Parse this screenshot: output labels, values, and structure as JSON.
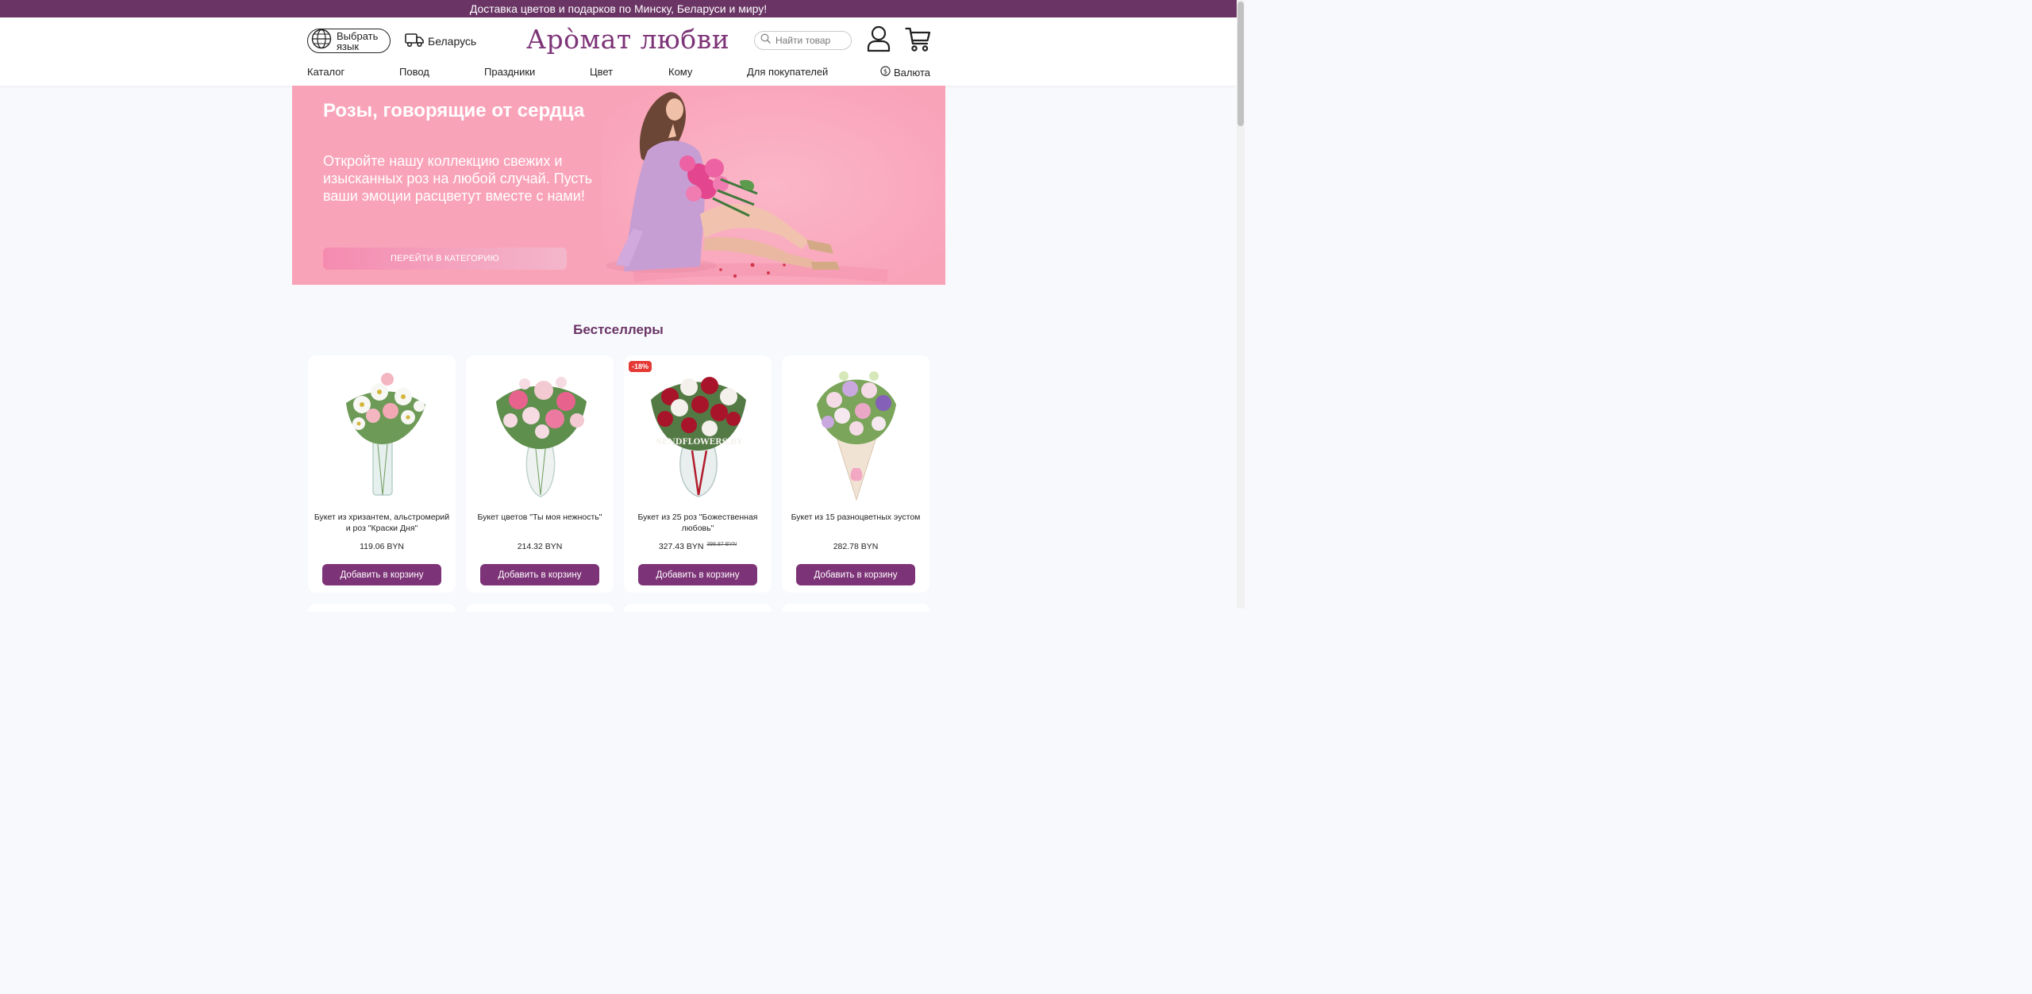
{
  "topbar": {
    "text": "Доставка цветов и подарков по Минску, Беларуси и миру!"
  },
  "header": {
    "language_button": "Выбрать язык",
    "country": "Беларусь",
    "logo": "Арòмат любви",
    "search_placeholder": "Найти товар",
    "icons": [
      "globe-icon",
      "truck-icon",
      "search-icon",
      "user-icon",
      "cart-icon"
    ]
  },
  "nav": {
    "items": [
      "Каталог",
      "Повод",
      "Праздники",
      "Цвет",
      "Кому",
      "Для покупателей"
    ],
    "currency": "Валюта"
  },
  "hero": {
    "title": "Розы, говорящие от сердца",
    "text": "Откройте нашу коллекцию свежих и изысканных роз на любой случай. Пусть ваши эмоции расцветут вместе с нами!",
    "button": "ПЕРЕЙТИ В КАТЕГОРИЮ"
  },
  "bestsellers": {
    "title": "Бестселлеры",
    "add_label": "Добавить в корзину",
    "products": [
      {
        "name": "Букет из хризантем, альстромерий и роз \"Краски Дня\"",
        "price": "119.06 BYN",
        "old_price": "",
        "badge": ""
      },
      {
        "name": "Букет цветов \"Ты моя нежность\"",
        "price": "214.32 BYN",
        "old_price": "",
        "badge": ""
      },
      {
        "name": "Букет из 25 роз \"Божественная любовь\"",
        "price": "327.43 BYN",
        "old_price": "398.87 BYN",
        "badge": "-18%",
        "watermark": "SENDFLOWERS.BY"
      },
      {
        "name": "Букет из 15 разноцветных эустом",
        "price": "282.78 BYN",
        "old_price": "",
        "badge": ""
      }
    ]
  },
  "colors": {
    "brand": "#6a3465",
    "button": "#7d3377",
    "hero_bg": "#f9a3b9",
    "badge": "#e53935"
  }
}
